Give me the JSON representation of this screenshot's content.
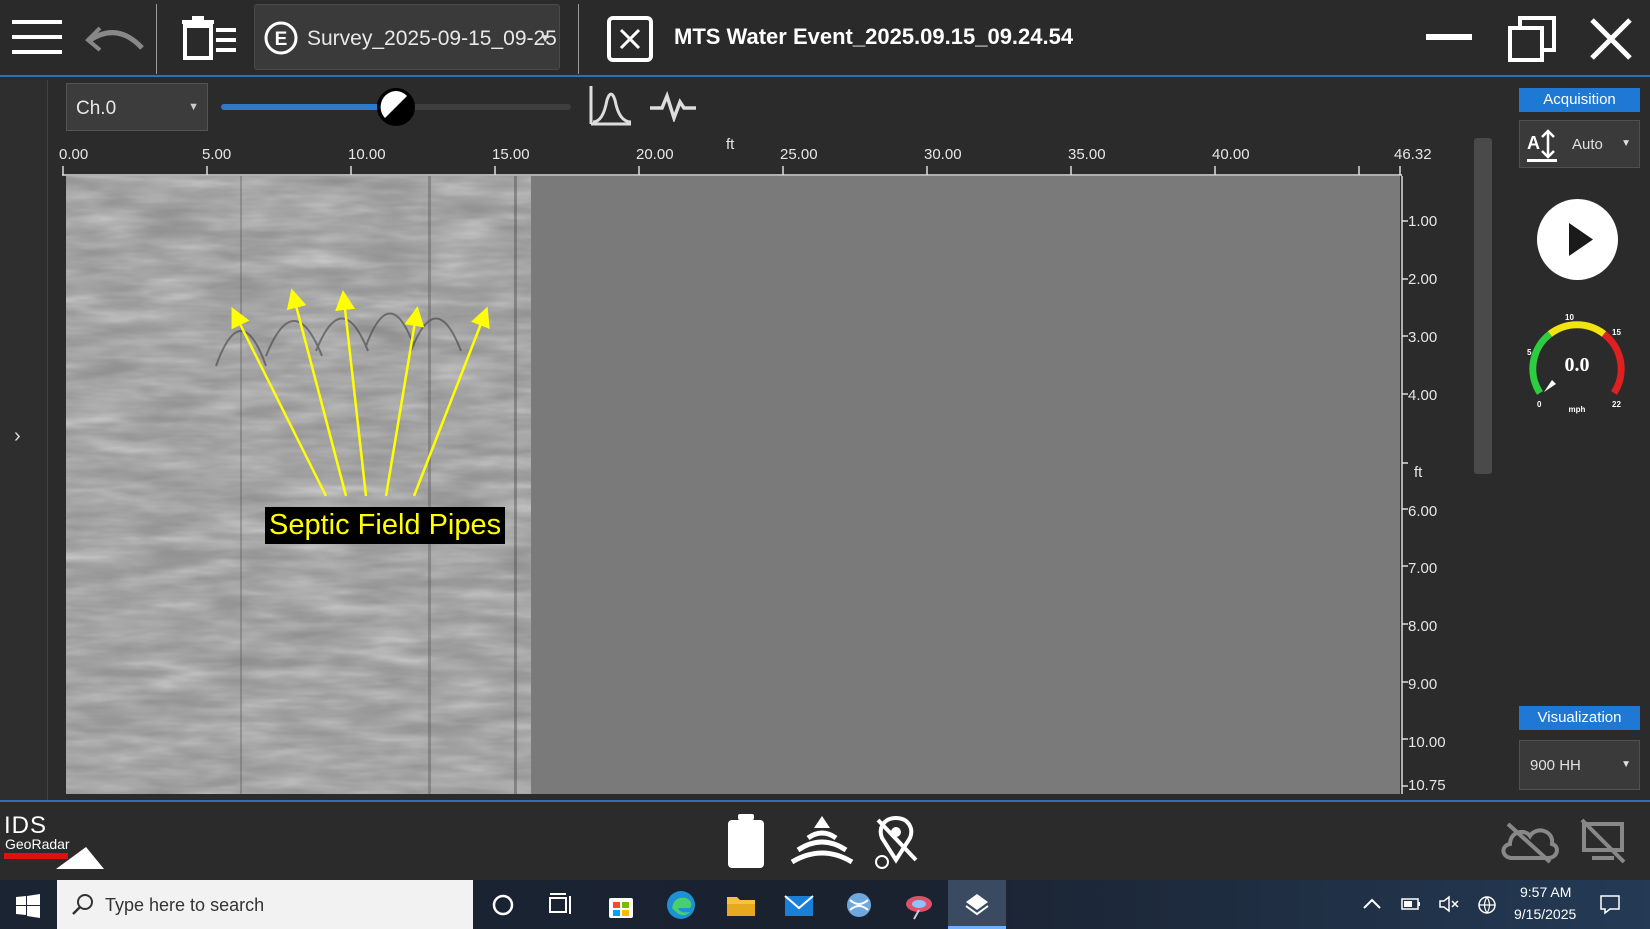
{
  "titlebar": {
    "survey_name": "Survey_2025-09-15_09-25",
    "event_title": "MTS Water Event_2025.09.15_09.24.54"
  },
  "toolbar": {
    "channel": "Ch.0",
    "gain_slider_level": 0.5
  },
  "ruler": {
    "unit": "ft",
    "ticks": [
      "0.00",
      "5.00",
      "10.00",
      "15.00",
      "20.00",
      "25.00",
      "30.00",
      "35.00",
      "40.00",
      "46.32"
    ],
    "depth_unit": "ft",
    "depth_ticks": [
      "1.00",
      "2.00",
      "3.00",
      "4.00",
      "6.00",
      "7.00",
      "8.00",
      "9.00",
      "10.00",
      "10.75"
    ]
  },
  "annotation": {
    "label": "Septic Field Pipes",
    "color": "#ffff00"
  },
  "right_panel": {
    "acquisition_label": "Acquisition",
    "acquisition_mode": "Auto",
    "visualization_label": "Visualization",
    "visualization_mode": "900 HH",
    "speed_value": "0.0",
    "speed_unit": "mph",
    "gauge_ticks": [
      "0",
      "5",
      "10",
      "15",
      "22"
    ]
  },
  "status": {
    "brand_line1": "IDS",
    "brand_line2": "GeoRadar"
  },
  "taskbar": {
    "search_placeholder": "Type here to search",
    "time": "9:57 AM",
    "date": "9/15/2025"
  },
  "colors": {
    "accent": "#1e78d4",
    "background": "#2b2b2b"
  }
}
